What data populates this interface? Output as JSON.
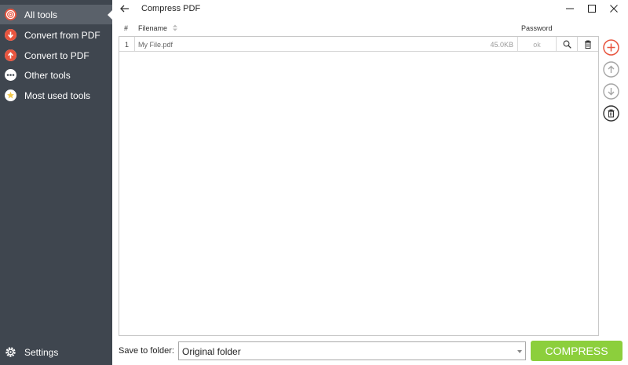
{
  "app": {
    "title": "Compress PDF"
  },
  "sidebar": {
    "items": [
      {
        "label": "All tools",
        "icon": "target-icon",
        "color": "#e8553f"
      },
      {
        "label": "Convert from PDF",
        "icon": "arrow-down-circle-icon",
        "color": "#e8553f"
      },
      {
        "label": "Convert to PDF",
        "icon": "arrow-up-circle-icon",
        "color": "#e8553f"
      },
      {
        "label": "Other tools",
        "icon": "more-dots-icon",
        "color": "#ffffff"
      },
      {
        "label": "Most used tools",
        "icon": "star-icon",
        "color": "#f2c94c"
      }
    ],
    "settings_label": "Settings"
  },
  "table": {
    "headers": {
      "number": "#",
      "filename": "Filename",
      "password": "Password"
    },
    "rows": [
      {
        "number": "1",
        "filename": "My File.pdf",
        "size": "45.0KB",
        "password": "ok"
      }
    ]
  },
  "bottom": {
    "save_label": "Save to folder:",
    "folder_value": "Original folder",
    "compress_label": "COMPRESS"
  },
  "colors": {
    "sidebar_bg": "#3f464f",
    "sidebar_active": "#5a616a",
    "accent_red": "#e8553f",
    "compress_green": "#8ccf3c"
  }
}
